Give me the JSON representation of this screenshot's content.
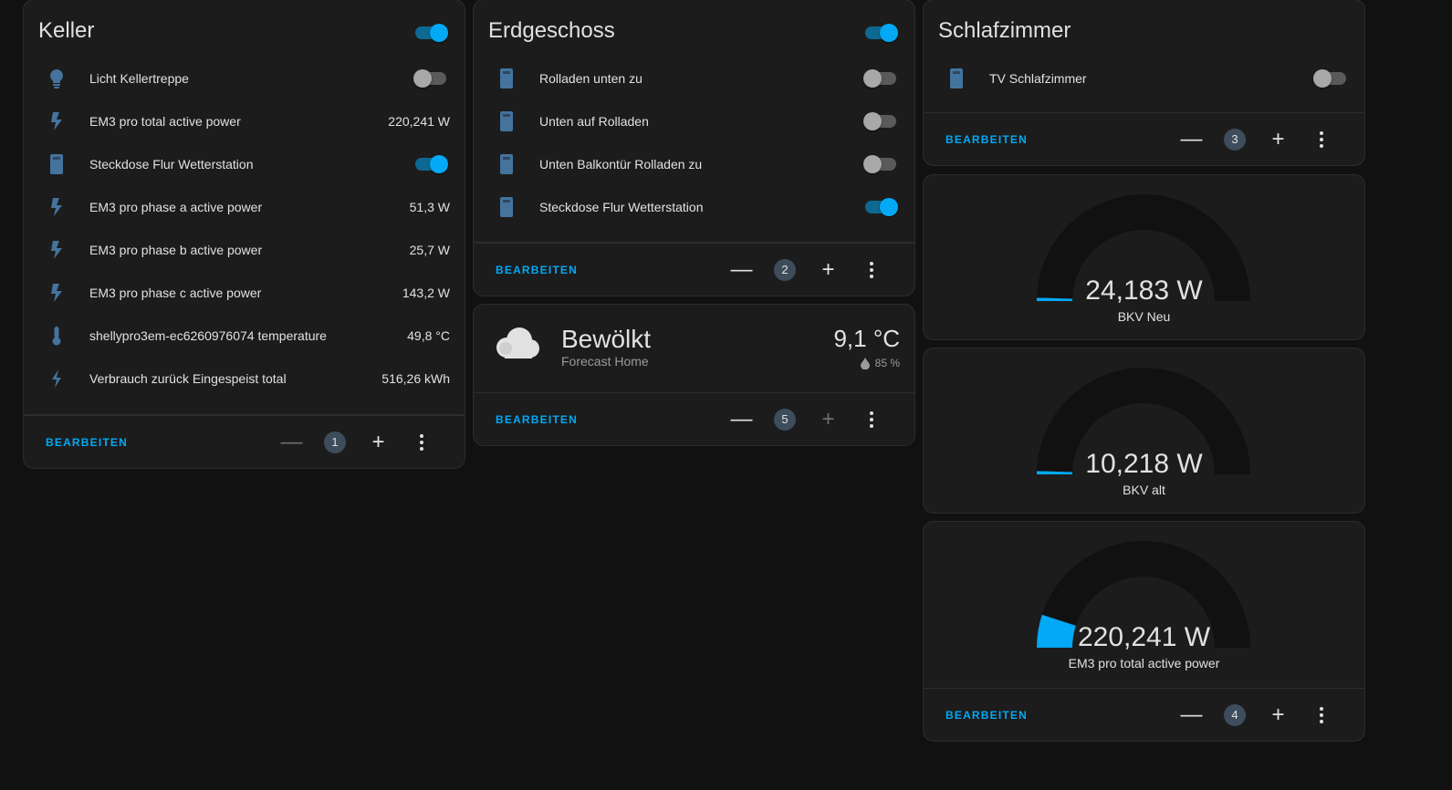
{
  "keller": {
    "title": "Keller",
    "header_toggle_on": true,
    "rows": [
      {
        "name": "Licht Kellertreppe",
        "icon": "lightbulb-icon"
      },
      {
        "name": "EM3 pro total active power",
        "value": "220,241 W",
        "icon": "flash-icon"
      },
      {
        "name": "Steckdose Flur Wetterstation",
        "icon": "socket-icon"
      },
      {
        "name": "EM3 pro phase a active power",
        "value": "51,3 W",
        "icon": "flash-icon"
      },
      {
        "name": "EM3 pro phase b active power",
        "value": "25,7 W",
        "icon": "flash-icon"
      },
      {
        "name": "EM3 pro phase c active power",
        "value": "143,2 W",
        "icon": "flash-icon"
      },
      {
        "name": "shellypro3em-ec6260976074 temperature",
        "value": "49,8 °C",
        "icon": "thermometer-icon"
      },
      {
        "name": "Verbrauch zurück Eingespeist total",
        "value": "516,26 kWh",
        "icon": "flash-icon"
      }
    ],
    "toggles": [
      false,
      true
    ],
    "footer": {
      "edit": "BEARBEITEN",
      "position": "1"
    }
  },
  "erdgeschoss": {
    "title": "Erdgeschoss",
    "header_toggle_on": true,
    "rows": [
      {
        "name": "Rolladen unten zu",
        "on": false,
        "icon": "socket-icon"
      },
      {
        "name": "Unten auf Rolladen",
        "on": false,
        "icon": "socket-icon"
      },
      {
        "name": "Unten Balkontür Rolladen zu",
        "on": false,
        "icon": "socket-icon"
      },
      {
        "name": "Steckdose Flur Wetterstation",
        "on": true,
        "icon": "socket-icon"
      }
    ],
    "footer": {
      "edit": "BEARBEITEN",
      "position": "2"
    }
  },
  "weather": {
    "condition": "Bewölkt",
    "name": "Forecast Home",
    "temperature": "9,1 °C",
    "humidity": "85 %",
    "icon": "cloud-icon",
    "footer": {
      "edit": "BEARBEITEN",
      "position": "5"
    }
  },
  "schlafzimmer": {
    "title": "Schlafzimmer",
    "rows": [
      {
        "name": "TV Schlafzimmer",
        "on": false,
        "icon": "socket-icon"
      }
    ],
    "footer": {
      "edit": "BEARBEITEN",
      "position": "3"
    }
  },
  "gauges": [
    {
      "value": "24,183 W",
      "name": "BKV Neu",
      "fraction": 0.01
    },
    {
      "value": "10,218 W",
      "name": "BKV alt",
      "fraction": 0.01
    },
    {
      "value": "220,241 W",
      "name": "EM3 pro total active power",
      "fraction": 0.1
    }
  ],
  "gauges_footer": {
    "edit": "BEARBEITEN",
    "position": "4"
  },
  "colors": {
    "accent": "#03a9f4",
    "icon": "#44739e",
    "card": "#1c1c1c",
    "background": "#111111"
  }
}
